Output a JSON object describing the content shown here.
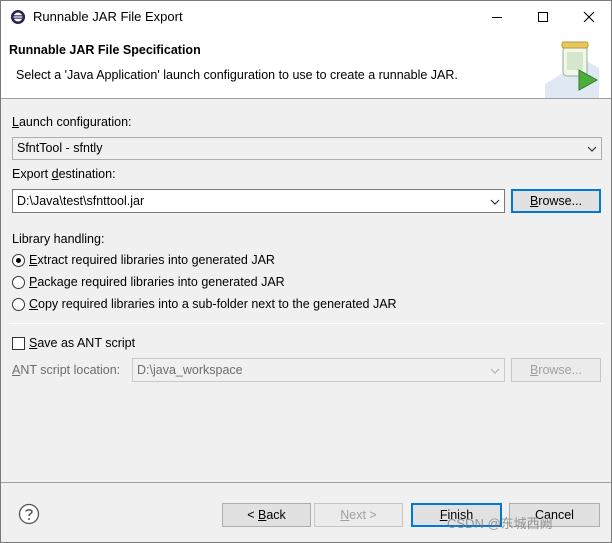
{
  "window": {
    "title": "Runnable JAR File Export",
    "icon": "eclipse-icon"
  },
  "banner": {
    "title": "Runnable JAR File Specification",
    "description": "Select a 'Java Application' launch configuration to use to create a runnable JAR.",
    "graphic": "jar-export-graphic"
  },
  "launch": {
    "label_prefix": "",
    "label_mnemonic": "L",
    "label_rest": "aunch configuration:",
    "value": "SfntTool - sfntly"
  },
  "export": {
    "label_prefix": "Export ",
    "label_mnemonic": "d",
    "label_rest": "estination:",
    "value": "D:\\Java\\test\\sfnttool.jar",
    "browse_mnemonic": "B",
    "browse_rest": "rowse..."
  },
  "library": {
    "heading": "Library handling:",
    "options": [
      {
        "mnemonic": "E",
        "rest": "xtract required libraries into generated JAR",
        "checked": true
      },
      {
        "mnemonic": "P",
        "rest": "ackage required libraries into generated JAR",
        "checked": false
      },
      {
        "mnemonic": "C",
        "rest": "opy required libraries into a sub-folder next to the generated JAR",
        "checked": false
      }
    ]
  },
  "ant": {
    "checkbox_mnemonic": "S",
    "checkbox_rest": "ave as ANT script",
    "checked": false,
    "location_mnemonic": "A",
    "location_rest": "NT script location:",
    "location_value": "D:\\java_workspace",
    "browse_mnemonic": "B",
    "browse_rest": "rowse..."
  },
  "footer": {
    "help_icon": "help-icon",
    "back_prefix": "< ",
    "back_mnemonic": "B",
    "back_rest": "ack",
    "next_mnemonic": "N",
    "next_rest": "ext >",
    "finish_mnemonic": "F",
    "finish_rest": "inish",
    "cancel_prefix": "Cancel",
    "watermark": "CSDN @东城西阙"
  }
}
